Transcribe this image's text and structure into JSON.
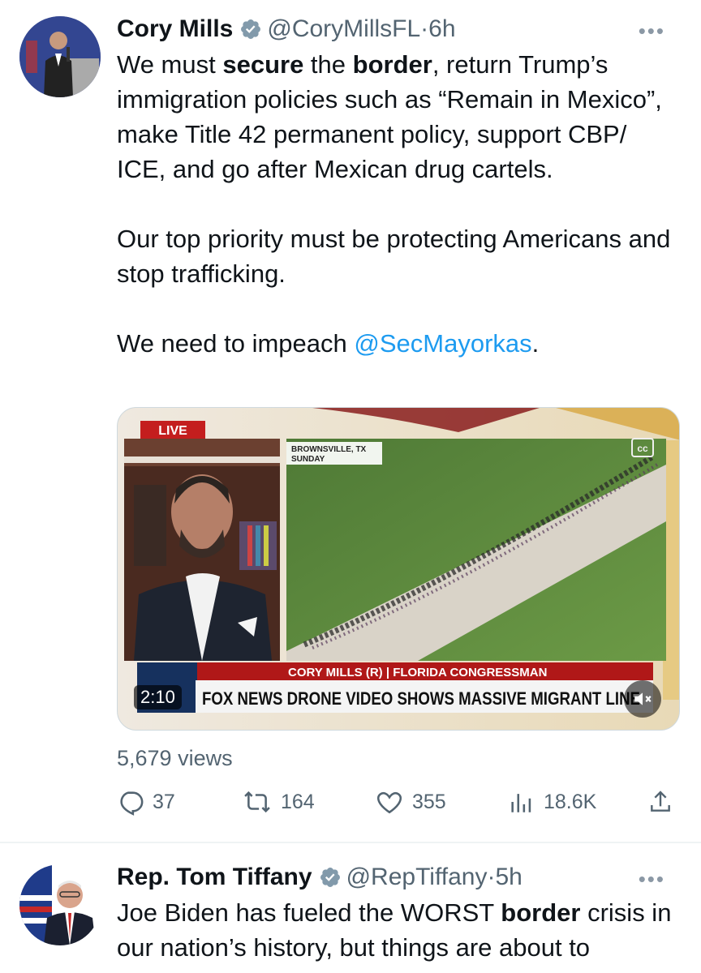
{
  "tweets": [
    {
      "author_name": "Cory Mills",
      "handle": "@CoryMillsFL",
      "separator": "·",
      "time": "6h",
      "body": {
        "p1_a": "We must ",
        "p1_b": "secure",
        "p1_c": " the ",
        "p1_d": "border",
        "p1_e": ", return Trump’s immigration policies such as “Remain in Mexico”, make Title 42 permanent policy, support CBP/ ICE, and go after Mexican drug cartels.",
        "p2": "Our top priority must be protecting Americans and stop trafficking.",
        "p3_a": "We need to impeach ",
        "p3_mention": "@SecMayorkas",
        "p3_c": "."
      },
      "video": {
        "live_label": "LIVE",
        "location_line1": "BROWNSVILLE, TX",
        "location_line2": "SUNDAY",
        "lower_third": "CORY MILLS (R) | FLORIDA CONGRESSMAN",
        "headline": "FOX NEWS DRONE VIDEO SHOWS MASSIVE MIGRANT LINE",
        "duration": "2:10",
        "cc_label": "cc",
        "mute_icon": "speaker-muted-icon"
      },
      "views": "5,679 views",
      "stats": {
        "replies": "37",
        "retweets": "164",
        "likes": "355",
        "analytics": "18.6K"
      }
    },
    {
      "author_name": "Rep. Tom Tiffany",
      "handle": "@RepTiffany",
      "separator": "·",
      "time": "5h",
      "body": {
        "a": "Joe Biden has fueled the WORST ",
        "b": "border",
        "c": " crisis in our nation’s history, but things are about to"
      }
    }
  ],
  "colors": {
    "accent": "#1d9bf0",
    "secondary_text": "#536471",
    "primary_text": "#0f1419",
    "divider": "#eff3f4"
  },
  "icons": [
    "verified-badge-icon",
    "more-icon",
    "reply-icon",
    "retweet-icon",
    "like-icon",
    "analytics-icon",
    "share-icon"
  ]
}
